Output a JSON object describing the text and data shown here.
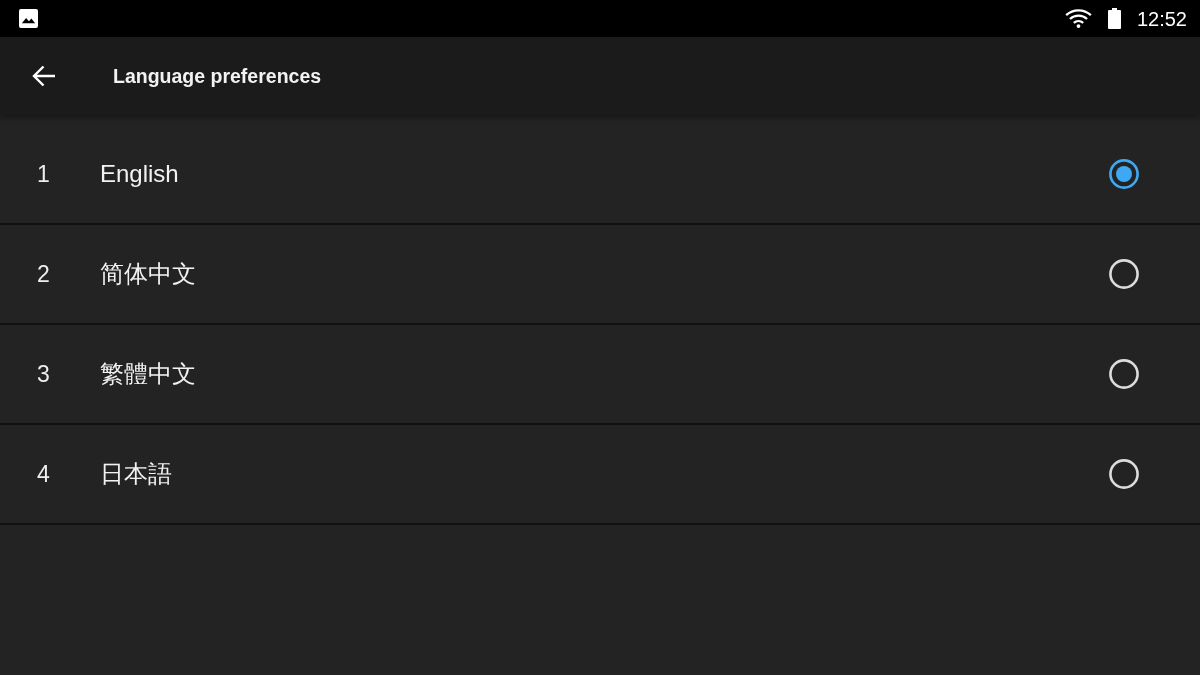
{
  "status_bar": {
    "time": "12:52"
  },
  "app_bar": {
    "title": "Language preferences"
  },
  "languages": [
    {
      "number": "1",
      "name": "English",
      "selected": true
    },
    {
      "number": "2",
      "name": "简体中文",
      "selected": false
    },
    {
      "number": "3",
      "name": "繁體中文",
      "selected": false
    },
    {
      "number": "4",
      "name": "日本語",
      "selected": false
    }
  ]
}
